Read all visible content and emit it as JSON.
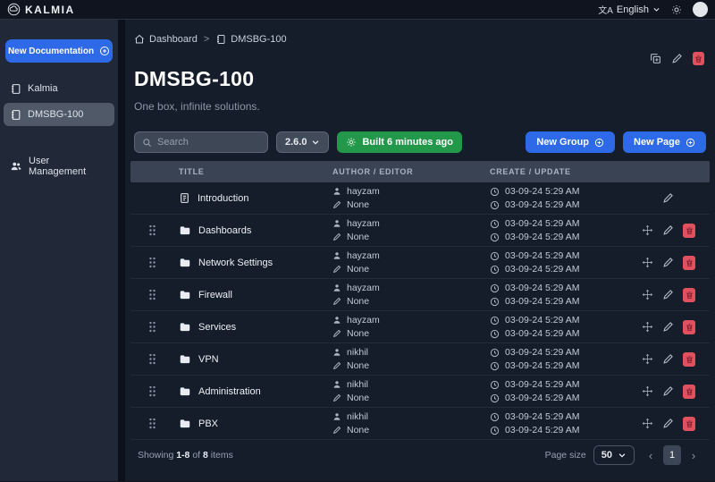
{
  "topbar": {
    "brand": "KALMIA",
    "language": "English"
  },
  "sidebar": {
    "new_documentation": "New Documentation",
    "items": [
      {
        "label": "Kalmia",
        "active": false
      },
      {
        "label": "DMSBG-100",
        "active": true
      }
    ],
    "user_management": "User Management"
  },
  "breadcrumb": {
    "dashboard": "Dashboard",
    "separator": ">",
    "current": "DMSBG-100"
  },
  "page": {
    "title": "DMSBG-100",
    "subtitle": "One box, infinite solutions."
  },
  "toolbar": {
    "search_placeholder": "Search",
    "version": "2.6.0",
    "build_status": "Built 6 minutes ago",
    "new_group": "New Group",
    "new_page": "New Page"
  },
  "table": {
    "columns": [
      "TITLE",
      "AUTHOR / EDITOR",
      "CREATE / UPDATE"
    ],
    "rows": [
      {
        "title": "Introduction",
        "type": "document",
        "author": "hayzam",
        "editor": "None",
        "created": "03-09-24 5:29 AM",
        "updated": "03-09-24 5:29 AM",
        "draggable": false,
        "actions": [
          "edit"
        ]
      },
      {
        "title": "Dashboards",
        "type": "folder",
        "author": "hayzam",
        "editor": "None",
        "created": "03-09-24 5:29 AM",
        "updated": "03-09-24 5:29 AM",
        "draggable": true,
        "actions": [
          "move",
          "edit",
          "delete"
        ]
      },
      {
        "title": "Network Settings",
        "type": "folder",
        "author": "hayzam",
        "editor": "None",
        "created": "03-09-24 5:29 AM",
        "updated": "03-09-24 5:29 AM",
        "draggable": true,
        "actions": [
          "move",
          "edit",
          "delete"
        ]
      },
      {
        "title": "Firewall",
        "type": "folder",
        "author": "hayzam",
        "editor": "None",
        "created": "03-09-24 5:29 AM",
        "updated": "03-09-24 5:29 AM",
        "draggable": true,
        "actions": [
          "move",
          "edit",
          "delete"
        ]
      },
      {
        "title": "Services",
        "type": "folder",
        "author": "hayzam",
        "editor": "None",
        "created": "03-09-24 5:29 AM",
        "updated": "03-09-24 5:29 AM",
        "draggable": true,
        "actions": [
          "move",
          "edit",
          "delete"
        ]
      },
      {
        "title": "VPN",
        "type": "folder",
        "author": "nikhil",
        "editor": "None",
        "created": "03-09-24 5:29 AM",
        "updated": "03-09-24 5:29 AM",
        "draggable": true,
        "actions": [
          "move",
          "edit",
          "delete"
        ]
      },
      {
        "title": "Administration",
        "type": "folder",
        "author": "nikhil",
        "editor": "None",
        "created": "03-09-24 5:29 AM",
        "updated": "03-09-24 5:29 AM",
        "draggable": true,
        "actions": [
          "move",
          "edit",
          "delete"
        ]
      },
      {
        "title": "PBX",
        "type": "folder",
        "author": "nikhil",
        "editor": "None",
        "created": "03-09-24 5:29 AM",
        "updated": "03-09-24 5:29 AM",
        "draggable": true,
        "actions": [
          "move",
          "edit",
          "delete"
        ]
      }
    ]
  },
  "footer": {
    "showing": "Showing",
    "range": "1-8",
    "of": "of",
    "total": "8",
    "items": "items",
    "page_size_label": "Page size",
    "page_size": "50",
    "current_page": "1"
  },
  "colors": {
    "accent": "#2e6ae8",
    "success": "#23984a",
    "danger": "#e0505f"
  }
}
